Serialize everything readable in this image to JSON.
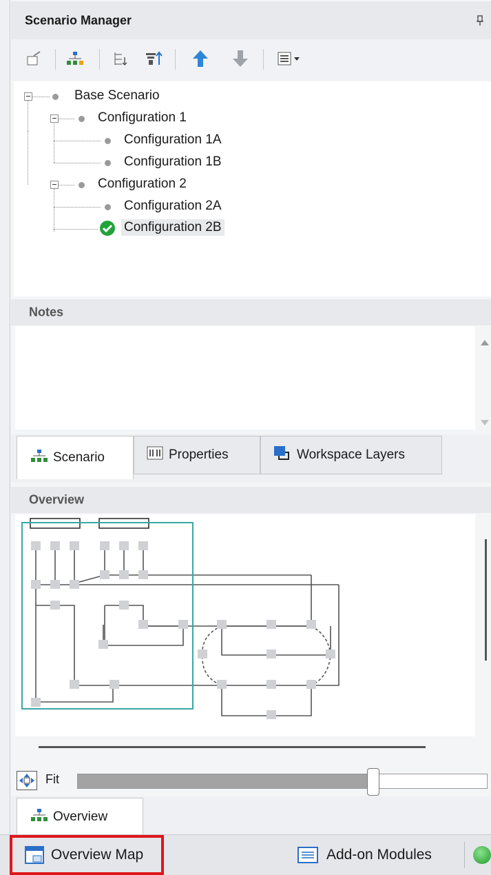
{
  "scenario_manager": {
    "title": "Scenario Manager",
    "pin_icon": "pin-icon",
    "toolbar": [
      {
        "name": "new-scenario-icon"
      },
      {
        "name": "child-scenario-icon"
      },
      {
        "name": "expand-tree-icon"
      },
      {
        "name": "filter-tree-icon"
      },
      {
        "name": "move-up-icon"
      },
      {
        "name": "move-down-icon"
      },
      {
        "name": "view-options-icon"
      }
    ],
    "tree": {
      "root": "Base Scenario",
      "configs": [
        {
          "label": "Configuration 1",
          "children": [
            "Configuration 1A",
            "Configuration 1B"
          ]
        },
        {
          "label": "Configuration 2",
          "children": [
            "Configuration 2A",
            "Configuration 2B"
          ]
        }
      ],
      "current": "Configuration 2B"
    }
  },
  "notes": {
    "title": "Notes"
  },
  "tabs": [
    {
      "label": "Scenario",
      "icon": "scenario-icon",
      "active": true
    },
    {
      "label": "Properties",
      "icon": "properties-icon",
      "active": false
    },
    {
      "label": "Workspace Layers",
      "icon": "layers-icon",
      "active": false
    }
  ],
  "overview": {
    "title": "Overview",
    "fit_label": "Fit",
    "zoom_level": 0.72,
    "tab_label": "Overview"
  },
  "statusbar": {
    "overview_map": "Overview Map",
    "addon_modules": "Add-on Modules",
    "highlight_color": "#e0161b"
  }
}
